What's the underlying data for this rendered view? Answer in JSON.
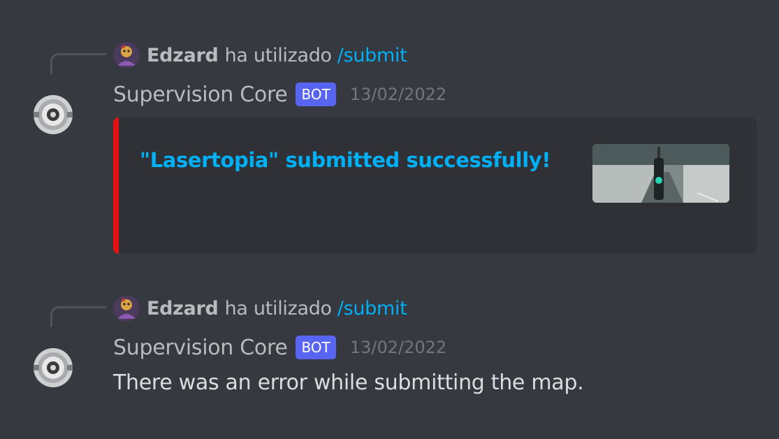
{
  "messages": [
    {
      "reply": {
        "user": "Edzard",
        "used_text": "ha utilizado",
        "command": "/submit"
      },
      "author": "Supervision Core",
      "tag": "BOT",
      "timestamp": "13/02/2022",
      "embed": {
        "title": "\"Lasertopia\" submitted successfully!",
        "color": "#e51212"
      }
    },
    {
      "reply": {
        "user": "Edzard",
        "used_text": "ha utilizado",
        "command": "/submit"
      },
      "author": "Supervision Core",
      "tag": "BOT",
      "timestamp": "13/02/2022",
      "content": "There was an error while submitting the map."
    }
  ],
  "colors": {
    "background": "#36393f",
    "embed_background": "#2f3136",
    "link": "#00aff4",
    "bot_tag": "#5865f2",
    "embed_accent": "#e51212"
  }
}
